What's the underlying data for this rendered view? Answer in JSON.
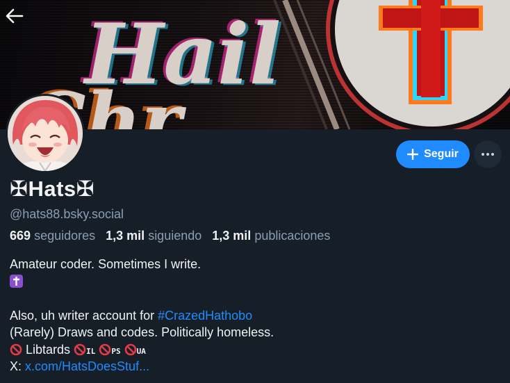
{
  "profile": {
    "display_name": "✠Hats✠",
    "handle": "@hats88.bsky.social",
    "followers_count": "669",
    "followers_label": "seguidores",
    "following_count": "1,3 mil",
    "following_label": "siguiendo",
    "posts_count": "1,3 mil",
    "posts_label": "publicaciones"
  },
  "banner": {
    "text": "Hail",
    "text2": "Chr"
  },
  "actions": {
    "follow_label": "Seguir"
  },
  "bio": {
    "line1": "Amateur coder. Sometimes I write.",
    "line4_prefix": "Also, uh writer account for ",
    "line4_hashtag": "#CrazedHathobo",
    "line5": "(Rarely) Draws and codes. Politically homeless.",
    "libtards": "Libtards",
    "code_il": "IL",
    "code_ps": "PS",
    "code_ua": "UA",
    "x_prefix": "X: ",
    "x_link": "x.com/HatsDoesStuf..."
  },
  "colors": {
    "background": "#161e27",
    "accent": "#208bfe",
    "muted": "#8c9eb2"
  },
  "icons": {
    "back": "arrow-left-icon",
    "follow": "plus-icon",
    "more": "ellipsis-icon",
    "cross": "latin-cross-icon",
    "prohibited": "prohibited-icon"
  }
}
